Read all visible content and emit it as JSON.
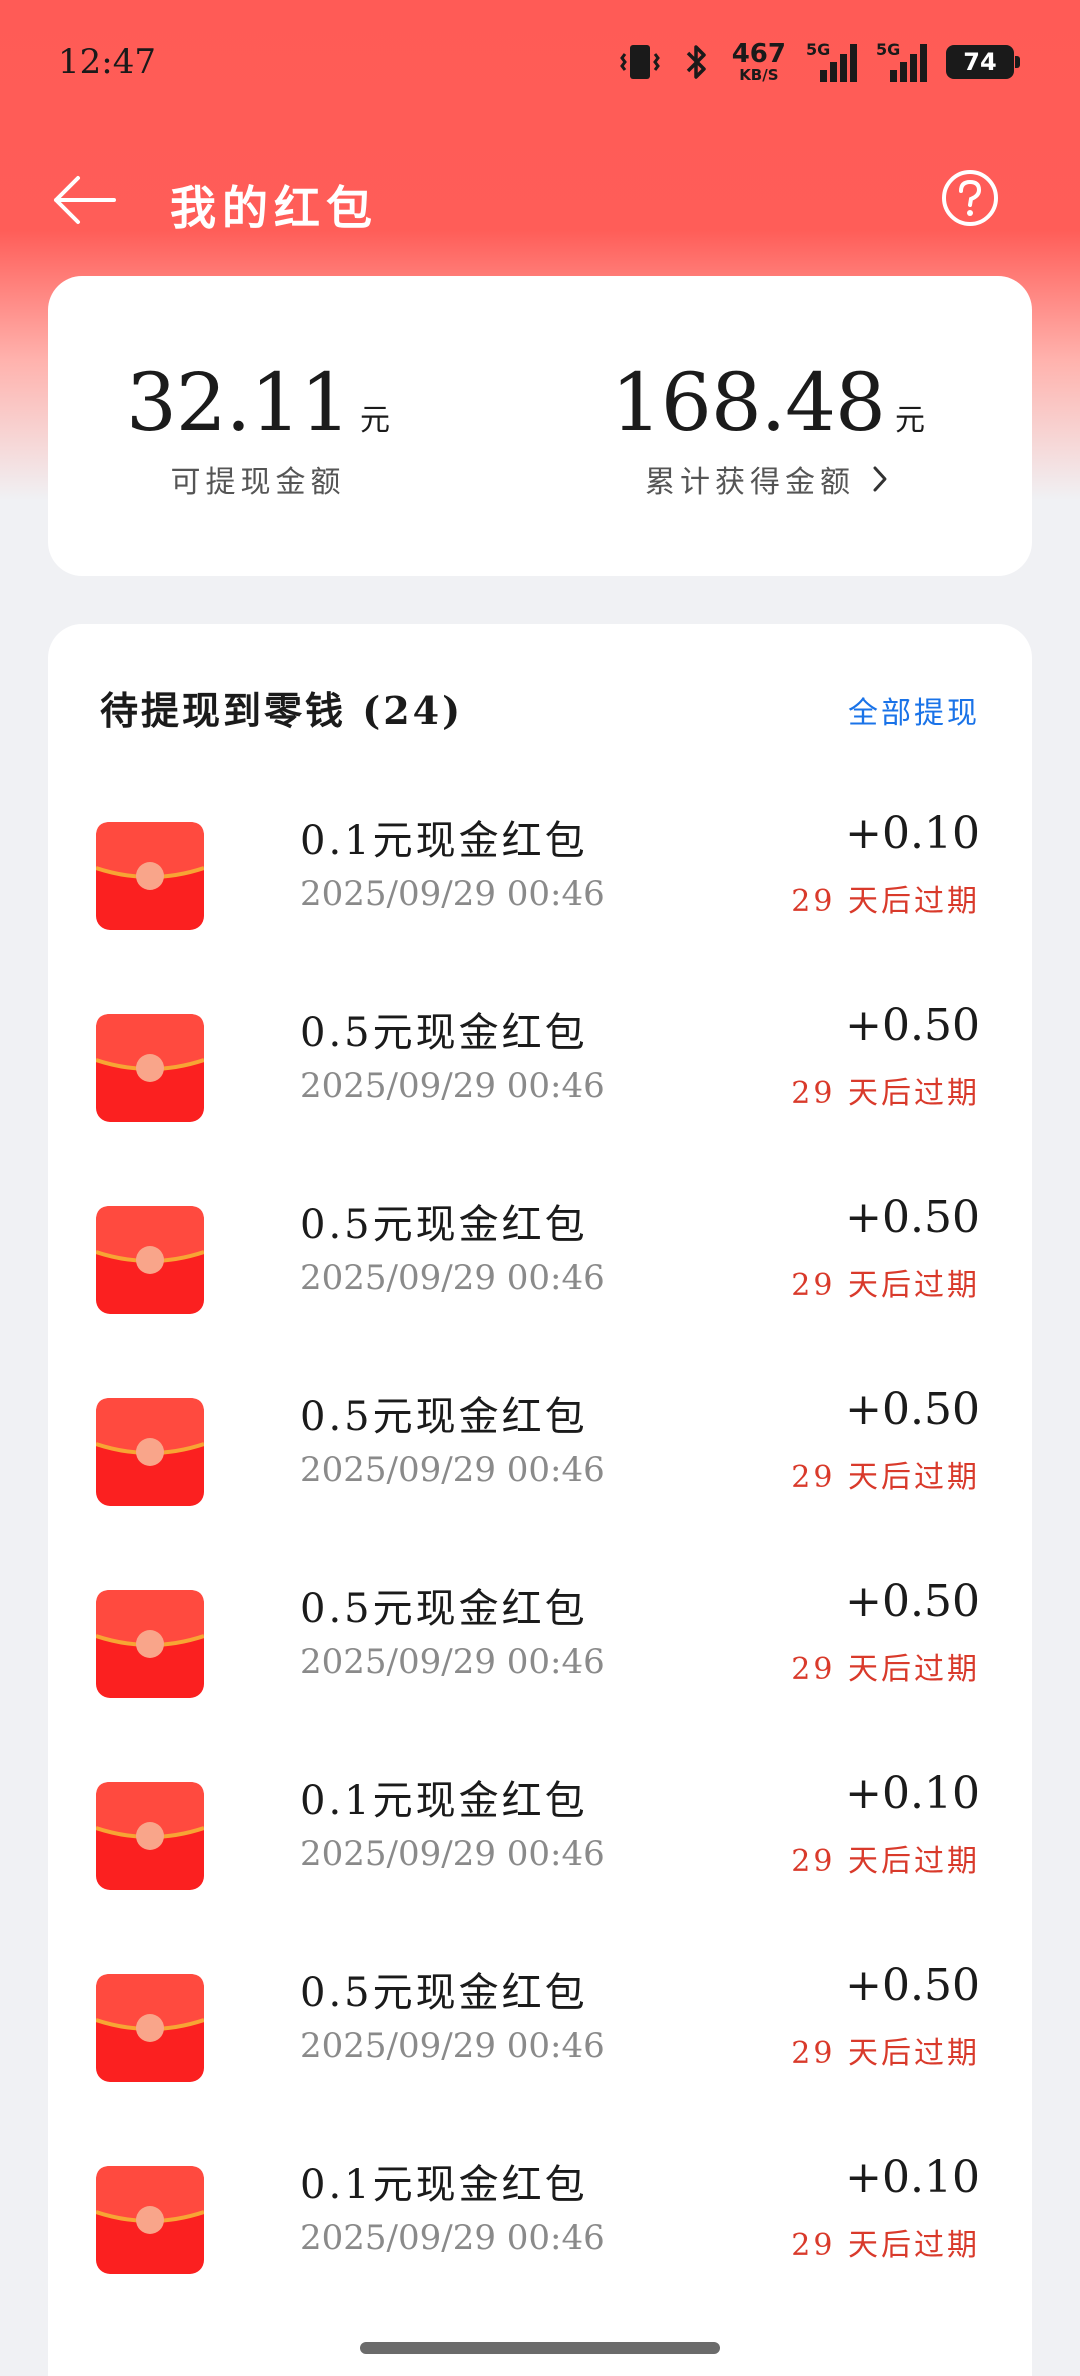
{
  "status_bar": {
    "time": "12:47",
    "net_speed": "467",
    "net_unit": "KB/S",
    "sig1_label": "5G",
    "sig2_label": "5G",
    "battery": "74"
  },
  "header": {
    "title": "我的红包",
    "back_icon": "arrow-left-icon",
    "help_icon": "question-circle-icon"
  },
  "summary": {
    "withdrawable_value": "32.11",
    "withdrawable_unit": "元",
    "withdrawable_label": "可提现金额",
    "total_value": "168.48",
    "total_unit": "元",
    "total_label": "累计获得金额"
  },
  "list": {
    "title": "待提现到零钱 (24)",
    "withdraw_all": "全部提现",
    "items": [
      {
        "name": "0.1元现金红包",
        "time": "2025/09/29 00:46",
        "amount": "+0.10",
        "expire": "29 天后过期"
      },
      {
        "name": "0.5元现金红包",
        "time": "2025/09/29 00:46",
        "amount": "+0.50",
        "expire": "29 天后过期"
      },
      {
        "name": "0.5元现金红包",
        "time": "2025/09/29 00:46",
        "amount": "+0.50",
        "expire": "29 天后过期"
      },
      {
        "name": "0.5元现金红包",
        "time": "2025/09/29 00:46",
        "amount": "+0.50",
        "expire": "29 天后过期"
      },
      {
        "name": "0.5元现金红包",
        "time": "2025/09/29 00:46",
        "amount": "+0.50",
        "expire": "29 天后过期"
      },
      {
        "name": "0.1元现金红包",
        "time": "2025/09/29 00:46",
        "amount": "+0.10",
        "expire": "29 天后过期"
      },
      {
        "name": "0.5元现金红包",
        "time": "2025/09/29 00:46",
        "amount": "+0.50",
        "expire": "29 天后过期"
      },
      {
        "name": "0.1元现金红包",
        "time": "2025/09/29 00:46",
        "amount": "+0.10",
        "expire": "29 天后过期"
      }
    ]
  },
  "colors": {
    "header_red": "#ff5b56",
    "envelope_red": "#fb2020",
    "expire_red": "#d93a2b",
    "link_blue": "#1a73e8"
  }
}
